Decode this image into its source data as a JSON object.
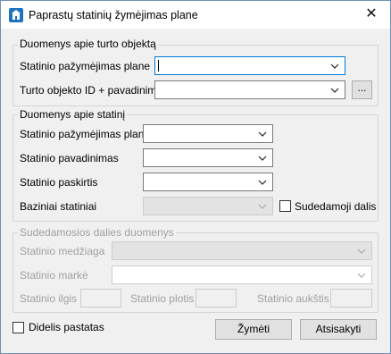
{
  "window": {
    "title": "Paprastų statinių žymėjimas plane",
    "close_glyph": "✕"
  },
  "group_object": {
    "legend": "Duomenys apie turto objektą",
    "field1_label": "Statinio pažymėjimas plane",
    "field1_value": "",
    "field2_label": "Turto objekto ID + pavadinimas",
    "field2_value": "",
    "browse_label": "..."
  },
  "group_building": {
    "legend": "Duomenys apie statinį",
    "mark_label": "Statinio pažymėjimas plane",
    "name_label": "Statinio pavadinimas",
    "purpose_label": "Statinio paskirtis",
    "base_label": "Baziniai statiniai",
    "composite_label": "Sudedamoji dalis",
    "composite_checked": false
  },
  "group_part": {
    "legend": "Sudedamosios dalies duomenys",
    "material_label": "Statinio medžiaga",
    "brand_label": "Statinio markė",
    "length_label": "Statinio ilgis",
    "width_label": "Statinio plotis",
    "height_label": "Statinio aukštis"
  },
  "footer": {
    "large_building_label": "Didelis pastatas",
    "large_building_checked": false,
    "mark_button": "Žymėti",
    "cancel_button": "Atsisakyti"
  },
  "icons": {
    "app": "building-icon",
    "dropdown": "chevron-down-icon"
  }
}
